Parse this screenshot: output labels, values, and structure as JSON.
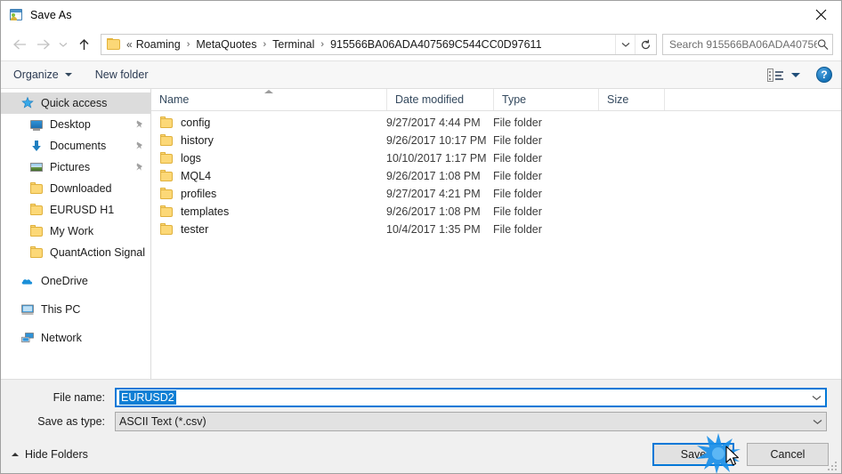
{
  "window": {
    "title": "Save As",
    "icon": "save-as-app-icon",
    "close_label": "✕"
  },
  "navigation": {
    "back_icon": "arrow-left-icon",
    "forward_icon": "arrow-right-icon",
    "recent_icon": "chevron-down-icon",
    "up_icon": "arrow-up-icon",
    "address": {
      "folder_icon": "folder-icon",
      "overflow": "«",
      "crumbs": [
        "Roaming",
        "MetaQuotes",
        "Terminal",
        "915566BA06ADA407569C544CC0D97611"
      ],
      "separator": "›",
      "dropdown_icon": "chevron-down-icon",
      "refresh_icon": "refresh-icon"
    },
    "search": {
      "placeholder": "Search 915566BA06ADA40756...",
      "icon": "search-icon"
    }
  },
  "toolbar": {
    "organize_label": "Organize",
    "new_folder_label": "New folder",
    "view_icon": "view-mode-icon",
    "help_label": "?",
    "help_icon": "help-icon"
  },
  "sidebar": {
    "items": [
      {
        "label": "Quick access",
        "icon": "star-icon",
        "level": "root",
        "selected": true,
        "pinned": false
      },
      {
        "label": "Desktop",
        "icon": "desktop-icon",
        "level": "child",
        "selected": false,
        "pinned": true
      },
      {
        "label": "Documents",
        "icon": "documents-download-icon",
        "level": "child",
        "selected": false,
        "pinned": true
      },
      {
        "label": "Pictures",
        "icon": "pictures-icon",
        "level": "child",
        "selected": false,
        "pinned": true
      },
      {
        "label": "Downloaded",
        "icon": "folder-icon",
        "level": "child",
        "selected": false,
        "pinned": false
      },
      {
        "label": "EURUSD H1",
        "icon": "folder-icon",
        "level": "child",
        "selected": false,
        "pinned": false
      },
      {
        "label": "My Work",
        "icon": "folder-icon",
        "level": "child",
        "selected": false,
        "pinned": false
      },
      {
        "label": "QuantAction Signal",
        "icon": "folder-icon",
        "level": "child",
        "selected": false,
        "pinned": false
      },
      {
        "label": "OneDrive",
        "icon": "onedrive-cloud-icon",
        "level": "root",
        "selected": false,
        "pinned": false,
        "gap_before": true
      },
      {
        "label": "This PC",
        "icon": "this-pc-icon",
        "level": "root",
        "selected": false,
        "pinned": false,
        "gap_before": true
      },
      {
        "label": "Network",
        "icon": "network-icon",
        "level": "root",
        "selected": false,
        "pinned": false,
        "gap_before": true
      }
    ]
  },
  "filelist": {
    "columns": [
      "Name",
      "Date modified",
      "Type",
      "Size"
    ],
    "sorted_column": "Name",
    "sort_direction": "ascending",
    "rows": [
      {
        "name": "config",
        "date": "9/27/2017 4:44 PM",
        "type": "File folder",
        "size": "",
        "icon": "folder-icon"
      },
      {
        "name": "history",
        "date": "9/26/2017 10:17 PM",
        "type": "File folder",
        "size": "",
        "icon": "folder-icon"
      },
      {
        "name": "logs",
        "date": "10/10/2017 1:17 PM",
        "type": "File folder",
        "size": "",
        "icon": "folder-icon"
      },
      {
        "name": "MQL4",
        "date": "9/26/2017 1:08 PM",
        "type": "File folder",
        "size": "",
        "icon": "folder-icon"
      },
      {
        "name": "profiles",
        "date": "9/27/2017 4:21 PM",
        "type": "File folder",
        "size": "",
        "icon": "folder-icon"
      },
      {
        "name": "templates",
        "date": "9/26/2017 1:08 PM",
        "type": "File folder",
        "size": "",
        "icon": "folder-icon"
      },
      {
        "name": "tester",
        "date": "10/4/2017 1:35 PM",
        "type": "File folder",
        "size": "",
        "icon": "folder-icon"
      }
    ]
  },
  "form": {
    "file_name_label": "File name:",
    "file_name_value": "EURUSD2",
    "file_name_selected": true,
    "save_as_type_label": "Save as type:",
    "save_as_type_value": "ASCII Text (*.csv)",
    "dropdown_icon": "chevron-down-icon"
  },
  "footer": {
    "hide_folders_label": "Hide Folders",
    "hide_folders_icon": "chevron-up-icon",
    "save_label": "Save",
    "cancel_label": "Cancel",
    "save_focused": true,
    "resize_grip_icon": "resize-grip-icon"
  },
  "overlay": {
    "click_effect_icon": "click-burst-icon",
    "cursor_icon": "mouse-cursor-icon"
  },
  "colors": {
    "accent": "#0078d7",
    "selection": "#0f7fd4",
    "folder": "#fcd877",
    "toolbar_bg": "#f7f7f7",
    "form_bg": "#f0f0f0"
  }
}
